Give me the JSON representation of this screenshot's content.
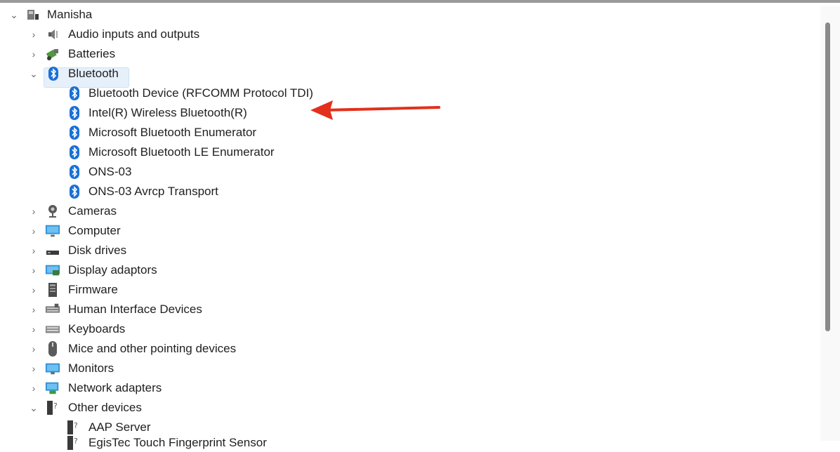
{
  "root": {
    "label": "Manisha",
    "icon": "computer-user-icon"
  },
  "categories": [
    {
      "label": "Audio inputs and outputs",
      "icon": "speaker-icon"
    },
    {
      "label": "Batteries",
      "icon": "battery-icon"
    },
    {
      "label": "Bluetooth",
      "icon": "bluetooth-icon"
    },
    {
      "label": "Cameras",
      "icon": "camera-icon"
    },
    {
      "label": "Computer",
      "icon": "monitor-icon"
    },
    {
      "label": "Disk drives",
      "icon": "disk-drive-icon"
    },
    {
      "label": "Display adaptors",
      "icon": "display-adapter-icon"
    },
    {
      "label": "Firmware",
      "icon": "firmware-icon"
    },
    {
      "label": "Human Interface Devices",
      "icon": "hid-icon"
    },
    {
      "label": "Keyboards",
      "icon": "keyboard-icon"
    },
    {
      "label": "Mice and other pointing devices",
      "icon": "mouse-icon"
    },
    {
      "label": "Monitors",
      "icon": "monitor-icon"
    },
    {
      "label": "Network adapters",
      "icon": "network-adapter-icon"
    },
    {
      "label": "Other devices",
      "icon": "unknown-device-icon"
    }
  ],
  "bluetooth_devices": [
    "Bluetooth Device (RFCOMM Protocol TDI)",
    "Intel(R) Wireless Bluetooth(R)",
    "Microsoft Bluetooth Enumerator",
    "Microsoft Bluetooth LE Enumerator",
    "ONS-03",
    "ONS-03 Avrcp Transport"
  ],
  "other_devices": [
    "AAP Server",
    "EgisTec Touch Fingerprint Sensor"
  ],
  "colors": {
    "bluetooth_blue": "#1a6fd6",
    "selection_bg": "#e6f0fb",
    "annotation_arrow": "#e2301c"
  }
}
